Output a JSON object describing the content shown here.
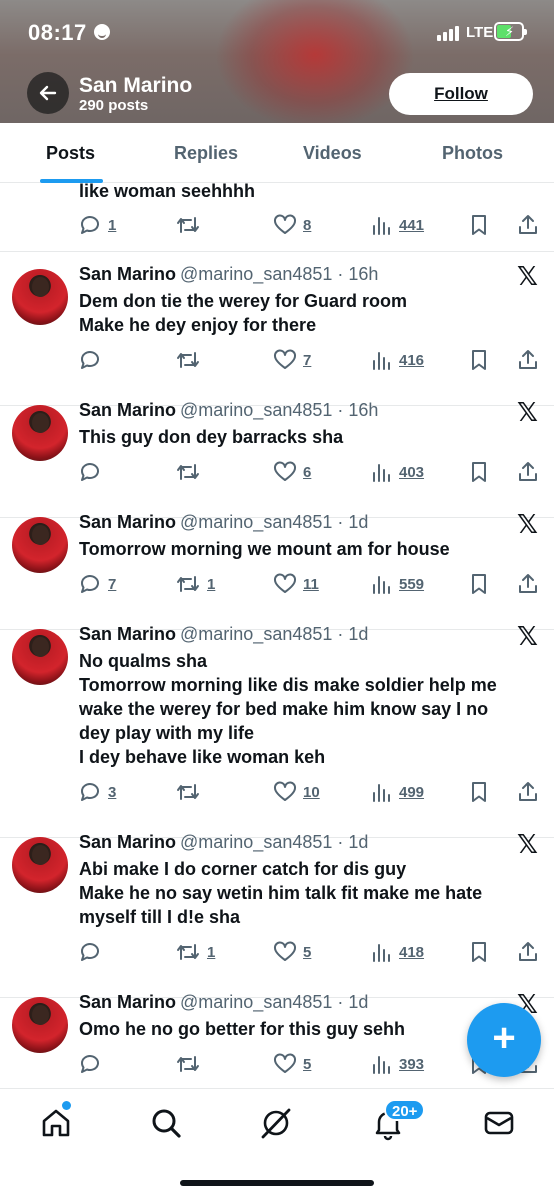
{
  "status_bar": {
    "time": "08:17",
    "network": "LTE"
  },
  "profile": {
    "name": "San Marino",
    "posts_count": "290 posts",
    "follow_label": "Follow"
  },
  "tabs": [
    {
      "label": "Posts",
      "active": true
    },
    {
      "label": "Replies",
      "active": false
    },
    {
      "label": "Videos",
      "active": false
    },
    {
      "label": "Photos",
      "active": false
    }
  ],
  "partial_post": {
    "text": "like woman seehhhh",
    "replies": "1",
    "reposts": "",
    "likes": "8",
    "views": "441"
  },
  "posts": [
    {
      "name": "San Marino",
      "handle": "@marino_san4851 · 16h",
      "text": [
        "Dem don tie the werey for Guard room",
        "Make he dey enjoy for there"
      ],
      "replies": "",
      "reposts": "",
      "likes": "7",
      "views": "416"
    },
    {
      "name": "San Marino",
      "handle": "@marino_san4851 · 16h",
      "text": [
        "This guy don dey barracks sha"
      ],
      "replies": "",
      "reposts": "",
      "likes": "6",
      "views": "403"
    },
    {
      "name": "San Marino",
      "handle": "@marino_san4851 · 1d",
      "text": [
        "Tomorrow morning we mount am for house"
      ],
      "replies": "7",
      "reposts": "1",
      "likes": "11",
      "views": "559"
    },
    {
      "name": "San Marino",
      "handle": "@marino_san4851 · 1d",
      "text": [
        "No qualms sha",
        "Tomorrow morning like dis make soldier help me",
        "wake the werey for bed make him know say I no",
        "dey play with my life",
        "I dey behave like woman keh"
      ],
      "replies": "3",
      "reposts": "",
      "likes": "10",
      "views": "499"
    },
    {
      "name": "San Marino",
      "handle": "@marino_san4851 · 1d",
      "text": [
        "Abi make I do corner catch for dis guy",
        "Make he no say wetin him talk fit make me hate",
        "myself till I d!e sha"
      ],
      "replies": "",
      "reposts": "1",
      "likes": "5",
      "views": "418"
    },
    {
      "name": "San Marino",
      "handle": "@marino_san4851 · 1d",
      "text": [
        "Omo he no go better for this guy sehh"
      ],
      "replies": "",
      "reposts": "",
      "likes": "5",
      "views": "393"
    }
  ],
  "fab": {
    "label": "+"
  },
  "bottom_nav": {
    "items": [
      "home-icon",
      "search-icon",
      "grok-icon",
      "bell-icon",
      "mail-icon"
    ],
    "notifications_badge": "20+"
  },
  "colors": {
    "accent": "#1d9bf0",
    "text": "#0f1419",
    "muted": "#536471"
  }
}
